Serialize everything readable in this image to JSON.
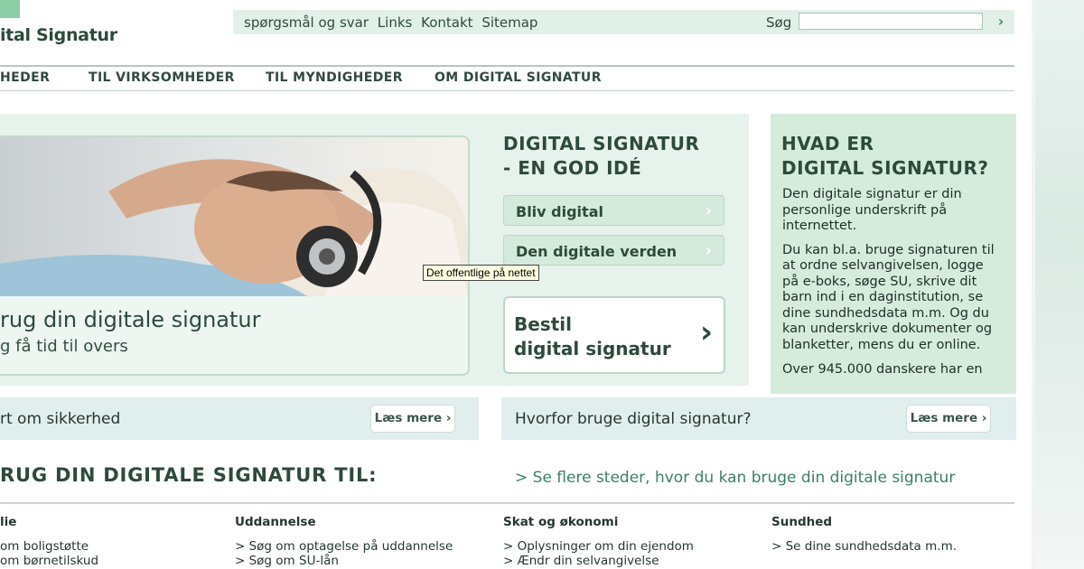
{
  "header": {
    "logo_text": "ital Signatur",
    "top_links": [
      "spørgsmål og svar",
      "Links",
      "Kontakt",
      "Sitemap"
    ],
    "search_label": "Søg",
    "search_value": "",
    "search_go": "›"
  },
  "nav": [
    "HEDER",
    "TIL VIRKSOMHEDER",
    "TIL MYNDIGHEDER",
    "OM DIGITAL SIGNATUR"
  ],
  "hero": {
    "title": "rug din digitale signatur",
    "subtitle": "g få tid til overs"
  },
  "middle": {
    "title_line1": "DIGITAL SIGNATUR",
    "title_line2": "- EN GOD IDÉ",
    "buttons": [
      "Bliv digital",
      "Den digitale verden"
    ],
    "bestil_line1": "Bestil",
    "bestil_line2": "digital signatur",
    "bestil_chev": "›"
  },
  "tooltip": "Det offentlige på nettet",
  "right": {
    "title_line1": "HVAD ER",
    "title_line2": "DIGITAL SIGNATUR?",
    "para1": "Den digitale signatur er din personlige underskrift på internettet.",
    "para2": "Du kan bl.a. bruge signaturen til at ordne selvangivelsen, logge på e-boks, søge SU, skrive dit barn ind i en daginstitution, se dine sundhedsdata m.m. Og du kan underskrive dokumenter og blanketter, mens du er online.",
    "para3": "Over 945.000 danskere har en"
  },
  "bars": {
    "left_text": "rt om sikkerhed",
    "right_text": "Hvorfor bruge digital signatur?",
    "read_more": "Læs mere ›"
  },
  "bottom": {
    "title": "RUG DIN DIGITALE SIGNATUR TIL:",
    "see_more": "> Se flere steder, hvor du kan bruge din digitale signatur",
    "columns": [
      {
        "head": "lie",
        "links": [
          "om boligstøtte",
          "om børnetilskud"
        ]
      },
      {
        "head": "Uddannelse",
        "links": [
          "> Søg om optagelse på uddannelse",
          "> Søg om SU-lån"
        ]
      },
      {
        "head": "Skat og økonomi",
        "links": [
          "> Oplysninger om din ejendom",
          "> Ændr din selvangivelse"
        ]
      },
      {
        "head": "Sundhed",
        "links": [
          "> Se dine sundhedsdata m.m."
        ]
      }
    ]
  },
  "colors": {
    "accent_green": "#2d4a3a",
    "panel_green": "#e6f2ec",
    "link_green": "#3c7f68"
  }
}
